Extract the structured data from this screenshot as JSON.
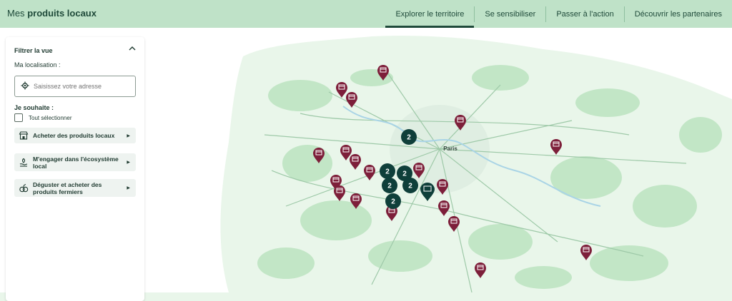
{
  "header": {
    "brand_prefix": "Mes",
    "brand_bold": "produits locaux",
    "nav": [
      {
        "label": "Explorer le territoire",
        "active": true
      },
      {
        "label": "Se sensibiliser",
        "active": false
      },
      {
        "label": "Passer à l'action",
        "active": false
      },
      {
        "label": "Découvrir les partenaires",
        "active": false
      }
    ]
  },
  "filter": {
    "title": "Filtrer la vue",
    "location_label": "Ma localisation :",
    "search_placeholder": "Saisissez votre adresse",
    "want_label": "Je souhaite :",
    "select_all": "Tout sélectionner",
    "options": [
      {
        "label": "Acheter des produits locaux",
        "icon": "shop-icon"
      },
      {
        "label": "M'engager dans l'écosystème local",
        "icon": "hand-leaf-icon"
      },
      {
        "label": "Déguster et acheter des produits fermiers",
        "icon": "fruit-icon"
      }
    ]
  },
  "map": {
    "city_center": "Paris",
    "cluster_count": "2",
    "colors": {
      "marker": "#7d1f3a",
      "cluster": "#0f3f3a",
      "road": "#9ec9a8",
      "urban": "#dfeee2",
      "land": "#e9f6ea",
      "forest": "#c2e6c6"
    }
  }
}
